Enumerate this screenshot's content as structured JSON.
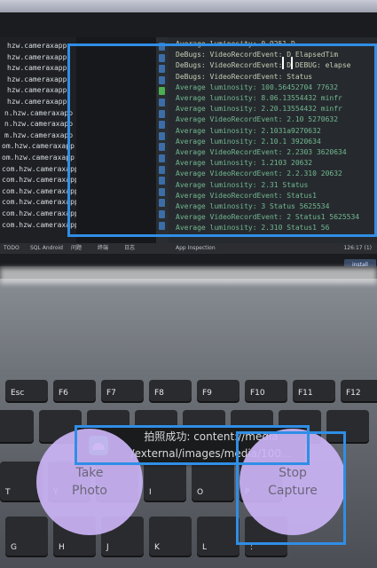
{
  "left_pane_rows": [
    "hzw.cameraxapp",
    "hzw.cameraxapp",
    "hzw.cameraxapp",
    "hzw.cameraxapp",
    "hzw.cameraxapp",
    "hzw.cameraxapp",
    "n.hzw.cameraxapp",
    "n.hzw.cameraxapp",
    "m.hzw.cameraxapp",
    "om.hzw.cameraxapp",
    "om.hzw.cameraxapp",
    "com.hzw.cameraxapp",
    "com.hzw.cameraxapp",
    "com.hzw.cameraxapp",
    "com.hzw.cameraxapp",
    "com.hzw.cameraxapp",
    "com.hzw.cameraxapp"
  ],
  "log_rows": [
    "Average luminosity: 0.9251 D",
    "DeBugs: VideoRecordEvent: D  ElapsedTim",
    "DeBugs: VideoRecordEvent: D  DEBUG: elapse",
    "DeBugs: VideoRecordEvent: Status",
    "Average luminosity: 100.56452704 77632",
    "Average luminosity: 8.06.13554432 minfr",
    "Average luminosity: 2.20.13554432 minfr",
    "Average VideoRecordEvent: 2.10 5270632",
    "Average luminosity: 2.1031a9270632",
    "Average luminosity: 2.10.1 3920634",
    "Average VideoRecordEvent: 2.2303 3620634",
    "Average luminosity: 1.2103 20632",
    "Average VideoRecordEvent: 2.2.310 20632",
    "Average luminosity: 2.31 Status",
    "Average VideoRecordEvent: Status1",
    "Average luminosity: 3 Status 5625534",
    "Average VideoRecordEvent: 2 Status1 5625534",
    "Average luminosity: 2.310 Status1 56"
  ],
  "popup_label": "install",
  "status_bar": [
    "TODO",
    "SQL Android",
    "问题",
    "终端",
    "日志",
    "App Inspection"
  ],
  "status_time": "126:17 (1)",
  "toast": {
    "line1": "拍照成功: content://media",
    "line2": "/external/images/media/100..."
  },
  "take_photo": {
    "line1": "Take",
    "line2": "Photo"
  },
  "stop_capture": {
    "line1": "Stop",
    "line2": "Capture"
  },
  "keys_row1": [
    "Esc",
    "F6",
    "F7",
    "F8",
    "F9",
    "F10",
    "F11",
    "F12"
  ],
  "keys_row3": [
    "T",
    "Y",
    "U",
    "I",
    "O",
    "P"
  ],
  "keys_row4": [
    "G",
    "H",
    "J",
    "K",
    "L",
    ":"
  ],
  "colors": {
    "highlight": "#2f8ee6",
    "button_fill": "#cbb4f6",
    "toast_bg": "#1a1b1d",
    "android_green": "#1ec26f"
  }
}
